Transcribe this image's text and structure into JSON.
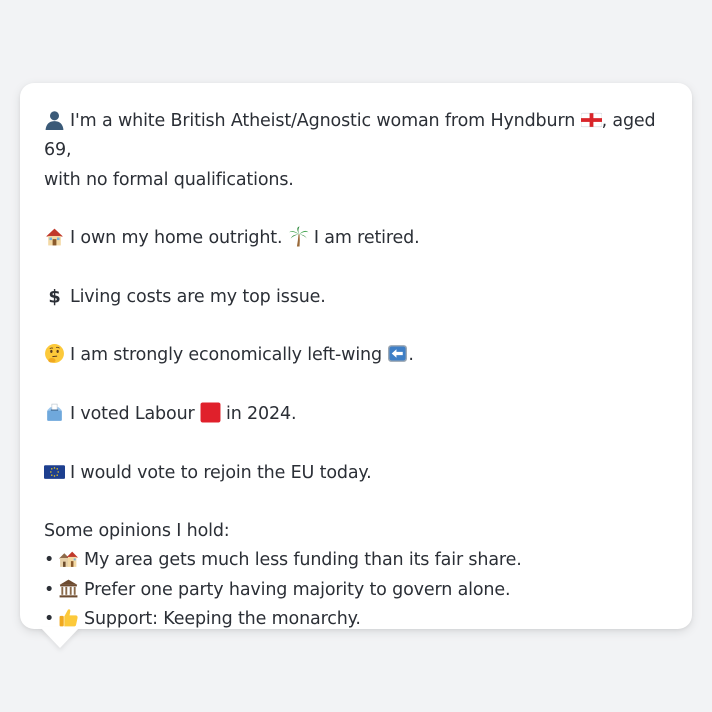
{
  "profile": {
    "intro_text": "I'm a white British Atheist/Agnostic woman from Hyndburn",
    "intro_suffix": ", aged 69,",
    "intro_line2": "with no formal qualifications.",
    "home_text": "I own my home outright.",
    "work_text": "I am retired.",
    "issue_text": "Living costs are my top issue.",
    "economic_text": "I am strongly economically left-wing",
    "economic_suffix": ".",
    "vote_text_before": "I voted Labour",
    "vote_text_after": "in 2024.",
    "eu_text": "I would vote to rejoin the EU today."
  },
  "opinions": {
    "heading": "Some opinions I hold:",
    "bullet": "•",
    "items": [
      {
        "icon": "houses-icon",
        "text": "My area gets much less funding than its fair share."
      },
      {
        "icon": "classical-building-icon",
        "text": "Prefer one party having majority to govern alone."
      },
      {
        "icon": "thumbs-up-icon",
        "text": "Support: Keeping the monarchy."
      }
    ]
  },
  "icons": {
    "person": "bust-silhouette-icon",
    "flag": "england-flag-icon",
    "home": "house-icon",
    "retired": "palm-tree-icon",
    "money": "dollar-sign-icon",
    "thinking": "thinking-face-icon",
    "left_arrow": "left-arrow-icon",
    "ballot": "ballot-box-icon",
    "labour": "red-square-icon",
    "eu": "eu-flag-icon"
  },
  "colors": {
    "background": "#f2f3f5",
    "card": "#ffffff",
    "text": "#2b2f36",
    "labour_red": "#e0202b",
    "eu_blue": "#1d3f8f",
    "arrow_blue": "#3f7fc6"
  }
}
